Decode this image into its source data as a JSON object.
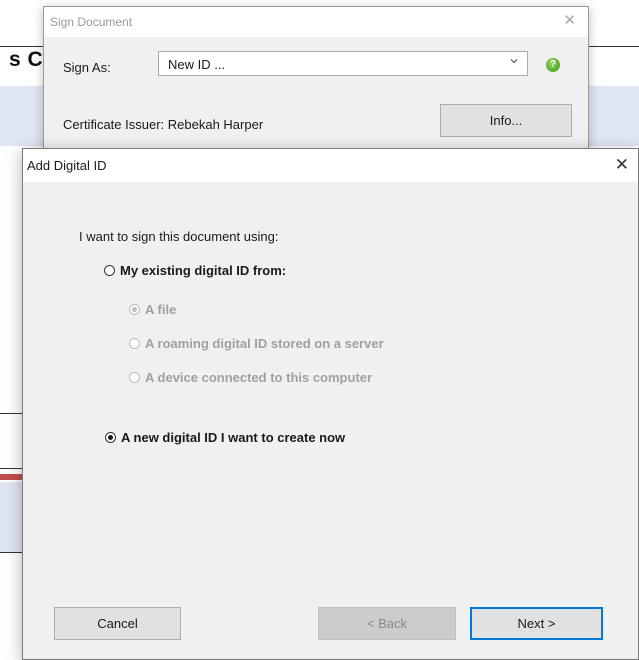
{
  "background_doc": {
    "heading": "s C"
  },
  "sign_dialog": {
    "title": "Sign Document",
    "close_glyph": "✕",
    "sign_as_label": "Sign As:",
    "sign_as_value": "New ID ...",
    "help_glyph": "?",
    "issuer_text": "Certificate Issuer: Rebekah Harper",
    "info_button": "Info..."
  },
  "add_dialog": {
    "title": "Add Digital ID",
    "close_glyph": "✕",
    "prompt": "I want to sign this document using:",
    "options": {
      "existing": {
        "label": "My existing digital ID from:",
        "selected": false,
        "enabled": true
      },
      "file": {
        "label": "A file",
        "selected": true,
        "enabled": false
      },
      "roaming": {
        "label": "A roaming digital ID stored on a server",
        "selected": false,
        "enabled": false
      },
      "device": {
        "label": "A device connected to this computer",
        "selected": false,
        "enabled": false
      },
      "new_id": {
        "label": "A new digital ID I want to create now",
        "selected": true,
        "enabled": true
      }
    },
    "buttons": {
      "cancel": "Cancel",
      "back": "< Back",
      "next": "Next >"
    }
  },
  "colors": {
    "dialog_bg": "#f0f0f0",
    "button_bg": "#e1e1e1",
    "default_button_border": "#0078d7",
    "help_icon": "#3f9a1c",
    "disabled_text": "#a0a0a0",
    "background_band": "#dfe5f3"
  }
}
